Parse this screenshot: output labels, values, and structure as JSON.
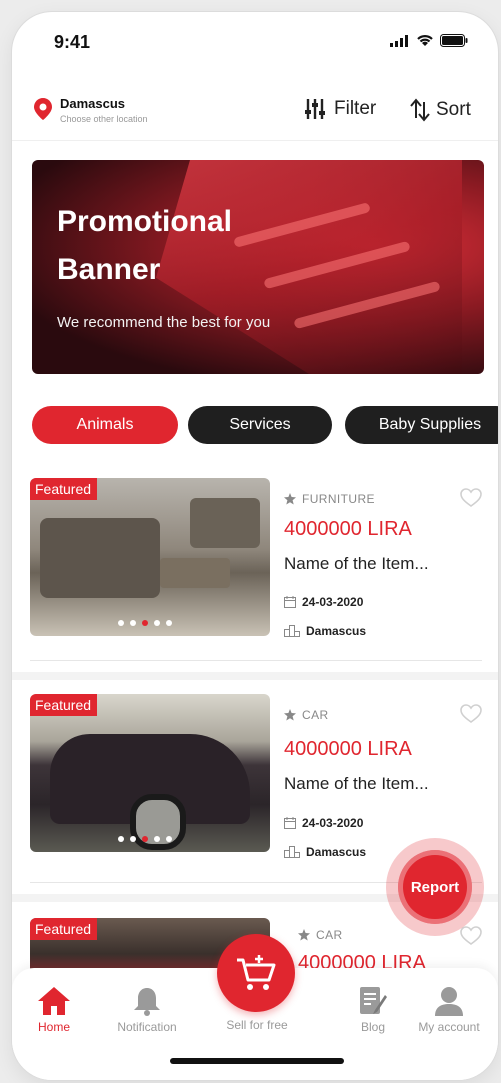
{
  "status": {
    "time": "9:41"
  },
  "location": {
    "city": "Damascus",
    "subtitle": "Choose other location"
  },
  "header": {
    "filter_label": "Filter",
    "sort_label": "Sort"
  },
  "banner": {
    "title_line1": "Promotional",
    "title_line2": "Banner",
    "subtitle": "We recommend the best for you"
  },
  "categories": [
    {
      "label": "Animals",
      "selected": true
    },
    {
      "label": "Services",
      "selected": false
    },
    {
      "label": "Baby Supplies",
      "selected": false
    }
  ],
  "listings": [
    {
      "badge": "Featured",
      "category": "FURNITURE",
      "price": "4000000 LIRA",
      "name": "Name of the Item...",
      "date": "24-03-2020",
      "city": "Damascus",
      "image": "sofa-photo"
    },
    {
      "badge": "Featured",
      "category": "CAR",
      "price": "4000000 LIRA",
      "name": "Name of the Item...",
      "date": "24-03-2020",
      "city": "Damascus",
      "image": "car-photo"
    },
    {
      "badge": "Featured",
      "category": "CAR",
      "price": "4000000 LIRA",
      "image": "car-photo"
    }
  ],
  "report": {
    "label": "Report"
  },
  "nav": {
    "home": "Home",
    "notification": "Notification",
    "sell": "Sell for free",
    "blog": "Blog",
    "account": "My account"
  },
  "colors": {
    "accent": "#e0262f",
    "chip_dark": "#1f1f1f"
  }
}
